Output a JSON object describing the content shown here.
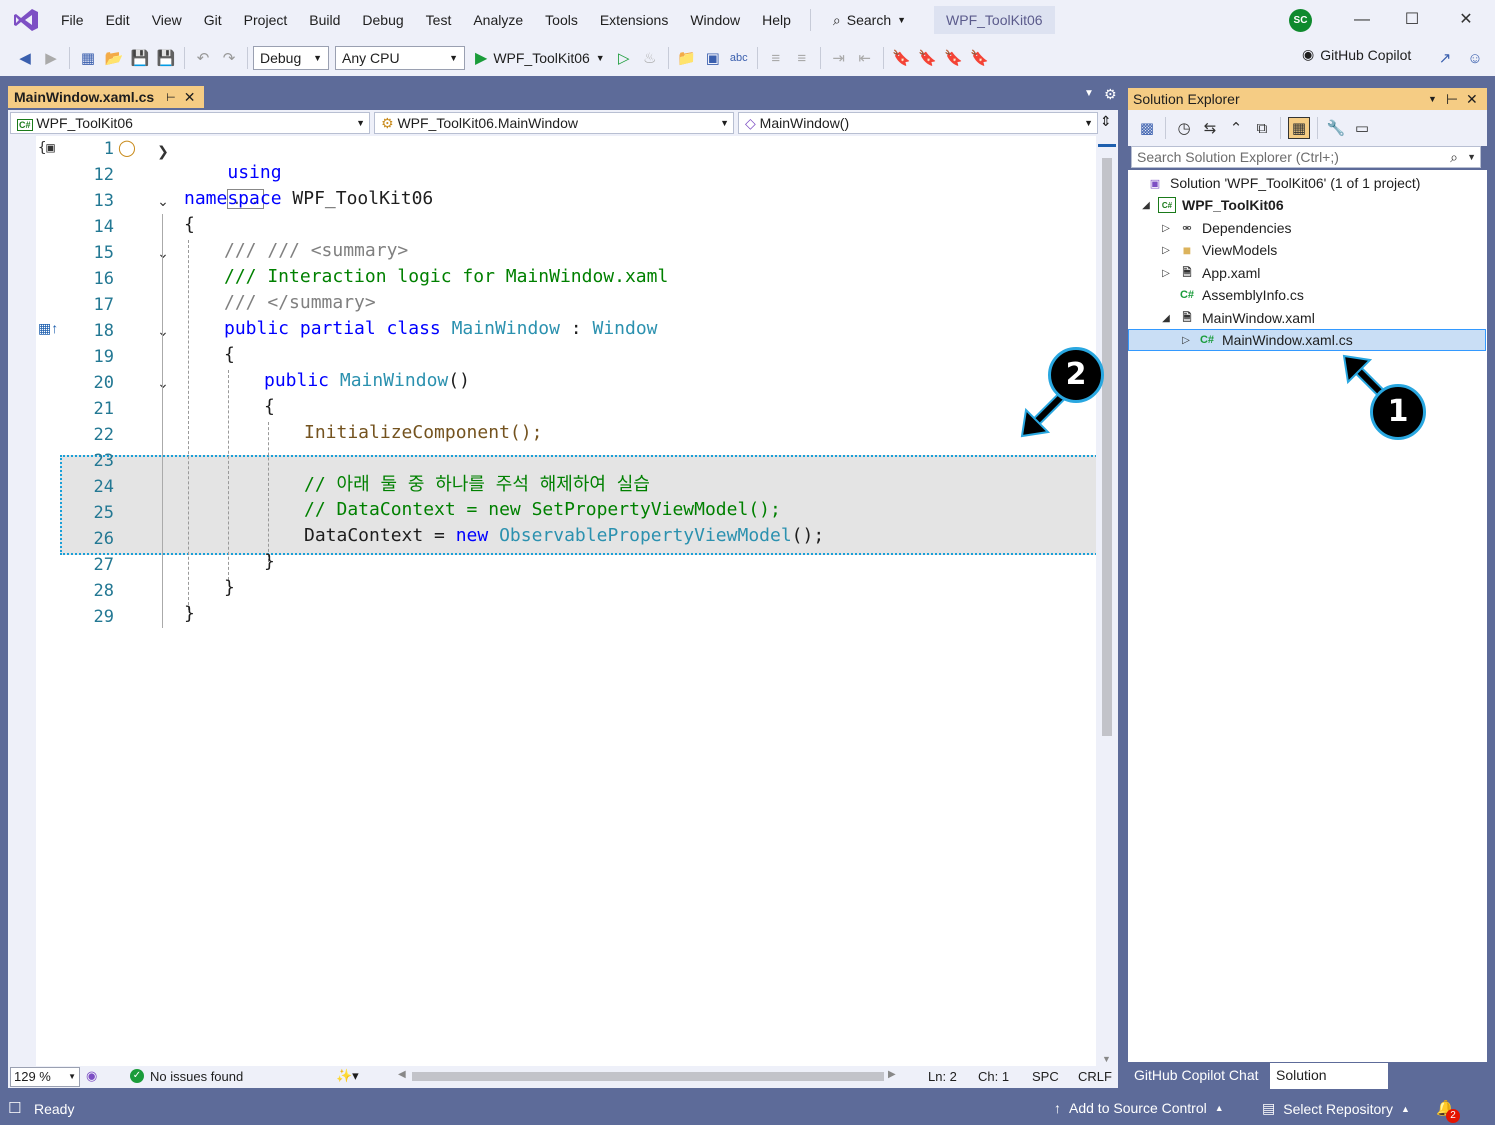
{
  "window": {
    "project_title": "WPF_ToolKit06",
    "avatar_initials": "SC"
  },
  "menu": [
    "File",
    "Edit",
    "View",
    "Git",
    "Project",
    "Build",
    "Debug",
    "Test",
    "Analyze",
    "Tools",
    "Extensions",
    "Window",
    "Help"
  ],
  "search": {
    "label": "Search"
  },
  "toolbar": {
    "config": "Debug",
    "platform": "Any CPU",
    "run_target": "WPF_ToolKit06",
    "copilot": "GitHub Copilot"
  },
  "document": {
    "tab_label": "MainWindow.xaml.cs",
    "nav_project": "WPF_ToolKit06",
    "nav_class": "WPF_ToolKit06.MainWindow",
    "nav_member": "MainWindow()"
  },
  "code": {
    "line_numbers": [
      "1",
      "12",
      "13",
      "14",
      "15",
      "16",
      "17",
      "18",
      "19",
      "20",
      "21",
      "22",
      "23",
      "24",
      "25",
      "26",
      "27",
      "28",
      "29"
    ],
    "l1_kw": "using",
    "l1_collapsed": "...",
    "l13_kw": "namespace",
    "l13_name": "WPF_ToolKit06",
    "l14": "{",
    "l15": "/// <summary>",
    "l16": "/// Interaction logic for MainWindow.xaml",
    "l17": "/// </summary>",
    "l18_kw": "public partial class",
    "l18_name": "MainWindow",
    "l18_colon": " : ",
    "l18_base": "Window",
    "l19": "{",
    "l20_kw": "public",
    "l20_name": "MainWindow",
    "l20_paren": "()",
    "l21": "{",
    "l22": "InitializeComponent();",
    "l24": "// 아래 둘 중 하나를 주석 해제하여 실습",
    "l25": "// DataContext = new SetPropertyViewModel();",
    "l26_a": "DataContext = ",
    "l26_kw": "new",
    "l26_type": " ObservablePropertyViewModel",
    "l26_end": "();",
    "l27": "}",
    "l28": "}",
    "l29": "}"
  },
  "editor_status": {
    "zoom": "129 %",
    "issues": "No issues found",
    "ln": "Ln: 2",
    "ch": "Ch: 1",
    "spc": "SPC",
    "crlf": "CRLF"
  },
  "solution_explorer": {
    "title": "Solution Explorer",
    "search_placeholder": "Search Solution Explorer (Ctrl+;)",
    "solution": "Solution 'WPF_ToolKit06' (1 of 1 project)",
    "project": "WPF_ToolKit06",
    "items": [
      "Dependencies",
      "ViewModels",
      "App.xaml",
      "AssemblyInfo.cs",
      "MainWindow.xaml",
      "MainWindow.xaml.cs"
    ],
    "tabs": [
      "GitHub Copilot Chat",
      "Solution Explorer"
    ]
  },
  "statusbar": {
    "ready": "Ready",
    "source_control": "Add to Source Control",
    "repository": "Select Repository",
    "notif_count": "2"
  },
  "callouts": [
    "1",
    "2"
  ],
  "colors": {
    "accent": "#5d6b99",
    "tab_active": "#f5cc84",
    "callout_border": "#29a7e0"
  }
}
